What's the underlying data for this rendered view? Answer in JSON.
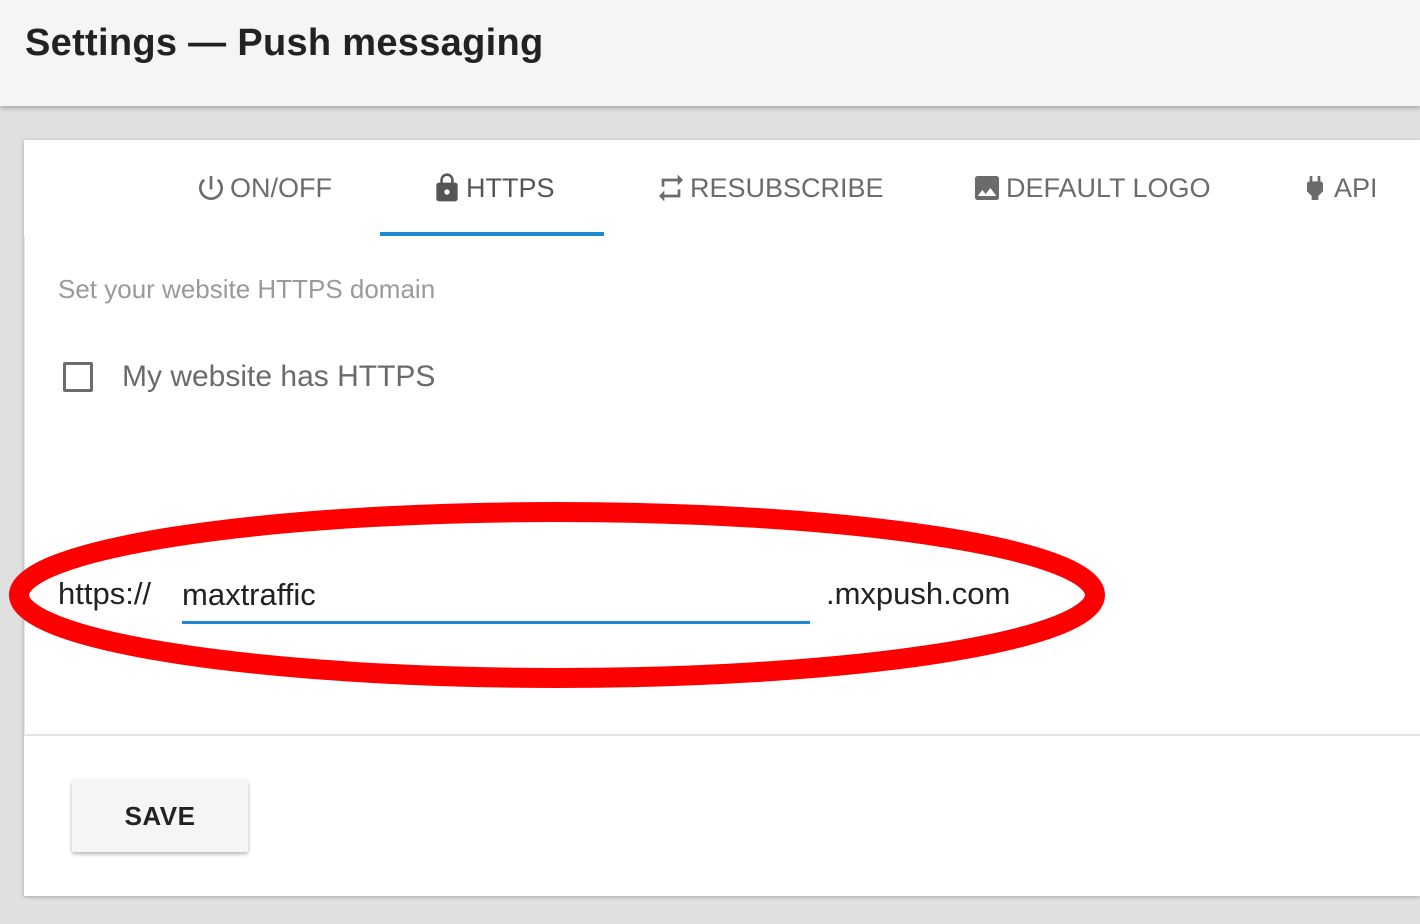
{
  "header": {
    "title": "Settings — Push messaging"
  },
  "tabs": [
    {
      "label": "ON/OFF",
      "icon": "power-icon"
    },
    {
      "label": "HTTPS",
      "icon": "lock-icon",
      "active": true
    },
    {
      "label": "RESUBSCRIBE",
      "icon": "repeat-icon"
    },
    {
      "label": "DEFAULT LOGO",
      "icon": "image-icon"
    },
    {
      "label": "API",
      "icon": "plug-icon"
    }
  ],
  "https": {
    "subtitle": "Set your website HTTPS domain",
    "checkbox_label": "My website has HTTPS",
    "checkbox_checked": false,
    "prefix": "https://",
    "domain_value": "maxtraffic",
    "suffix": ".mxpush.com"
  },
  "footer": {
    "save_label": "SAVE"
  },
  "colors": {
    "accent": "#1e88d2",
    "annotation": "#ff0000"
  }
}
